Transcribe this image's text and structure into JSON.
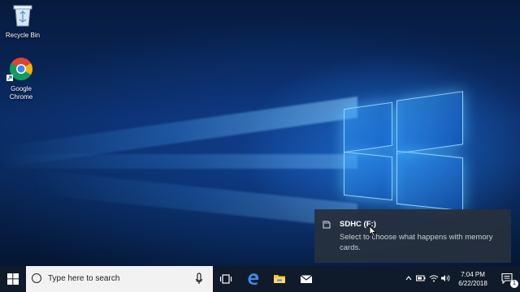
{
  "desktop": {
    "icons": [
      {
        "label": "Recycle Bin",
        "icon": "recycle-bin-icon"
      },
      {
        "label": "Google\nChrome",
        "icon": "chrome-icon"
      }
    ]
  },
  "toast": {
    "title": "SDHC (F:)",
    "body": "Select to choose what happens with memory cards."
  },
  "taskbar": {
    "search_placeholder": "Type here to search",
    "pinned": [
      "task-view-icon",
      "edge-icon",
      "file-explorer-icon",
      "mail-icon"
    ],
    "time": "7:04 PM",
    "date": "6/22/2018",
    "notification_count": "1"
  },
  "colors": {
    "accent": "#1e90ff",
    "taskbar": "#0f1a2a",
    "toast_bg": "#26303e"
  }
}
